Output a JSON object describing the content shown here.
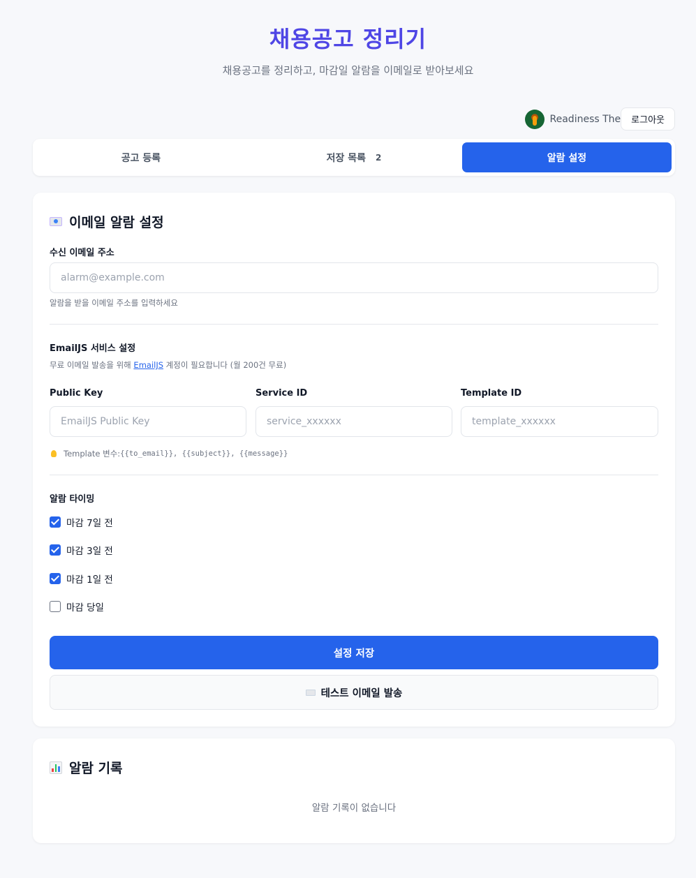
{
  "header": {
    "title": "채용공고 정리기",
    "subtitle": "채용공고를 정리하고, 마감일 알람을 이메일로 받아보세요"
  },
  "user": {
    "name": "Readiness The",
    "logout_label": "로그아웃"
  },
  "tabs": [
    {
      "label": "공고 등록",
      "active": false
    },
    {
      "label": "저장 목록",
      "badge": "2",
      "active": false
    },
    {
      "label": "알람 설정",
      "active": true
    }
  ],
  "settings": {
    "title": "이메일 알람 설정",
    "title_icon": "envelope-icon",
    "email": {
      "label": "수신 이메일 주소",
      "placeholder": "alarm@example.com",
      "value": "",
      "hint": "알람을 받을 이메일 주소를 입력하세요"
    },
    "emailjs": {
      "section_title": "EmailJS 서비스 설정",
      "hint_prefix": "무료 이메일 발송을 위해 ",
      "hint_link": "EmailJS",
      "hint_suffix": " 계정이 필요합니다 (월 200건 무료)",
      "public_key": {
        "label": "Public Key",
        "placeholder": "EmailJS Public Key"
      },
      "service_id": {
        "label": "Service ID",
        "placeholder": "service_xxxxxx"
      },
      "template_id": {
        "label": "Template ID",
        "placeholder": "template_xxxxxx"
      },
      "template_hint_label": "Template 변수: ",
      "template_hint_vars": "{{to_email}}, {{subject}}, {{message}}"
    },
    "timing": {
      "section_title": "알람 타이밍",
      "options": [
        {
          "label": "마감 7일 전",
          "checked": true
        },
        {
          "label": "마감 3일 전",
          "checked": true
        },
        {
          "label": "마감 1일 전",
          "checked": true
        },
        {
          "label": "마감 당일",
          "checked": false
        }
      ]
    },
    "save_label": "설정 저장",
    "test_label": "테스트 이메일 발송"
  },
  "log": {
    "title": "알람 기록",
    "title_icon": "bar-chart-icon",
    "empty_text": "알람 기록이 없습니다"
  },
  "colors": {
    "accent": "#2563eb",
    "title": "#4f46e5",
    "background": "#f7f8fb"
  }
}
